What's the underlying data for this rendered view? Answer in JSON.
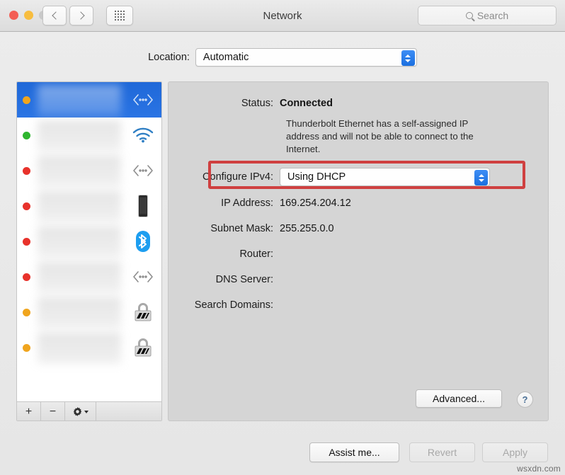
{
  "window": {
    "title": "Network",
    "traffic_lights": [
      {
        "name": "close",
        "color": "#f35e55"
      },
      {
        "name": "minimize",
        "color": "#f7bd3f"
      },
      {
        "name": "zoom",
        "color": "#c9c9c9"
      }
    ],
    "nav": {
      "back": "back-icon",
      "forward": "forward-icon",
      "show_all": "grid-icon"
    },
    "search": {
      "placeholder": "Search",
      "value": "",
      "icon": "search-icon"
    }
  },
  "location": {
    "label": "Location:",
    "selected": "Automatic"
  },
  "sidebar": {
    "services": [
      {
        "status": "orange",
        "icon": "ethernet-icon",
        "label": "",
        "selected": true
      },
      {
        "status": "green",
        "icon": "wifi-icon",
        "label": "",
        "selected": false
      },
      {
        "status": "red",
        "icon": "ethernet-icon",
        "label": "",
        "selected": false
      },
      {
        "status": "red",
        "icon": "iphone-icon",
        "label": "",
        "selected": false
      },
      {
        "status": "red",
        "icon": "bluetooth-icon",
        "label": "",
        "selected": false
      },
      {
        "status": "red",
        "icon": "ethernet-icon",
        "label": "",
        "selected": false
      },
      {
        "status": "orange",
        "icon": "vpn-lock-icon",
        "label": "",
        "selected": false
      },
      {
        "status": "orange",
        "icon": "vpn-lock-icon",
        "label": "",
        "selected": false
      }
    ],
    "toolbar": {
      "add": "+",
      "remove": "−",
      "actions": "gear-icon"
    }
  },
  "detail": {
    "status_label": "Status:",
    "status_value": "Connected",
    "status_description": "Thunderbolt Ethernet has a self-assigned IP address and will not be able to connect to the Internet.",
    "configure_label": "Configure IPv4:",
    "configure_value": "Using DHCP",
    "fields": [
      {
        "label": "IP Address:",
        "value": "169.254.204.12"
      },
      {
        "label": "Subnet Mask:",
        "value": "255.255.0.0"
      },
      {
        "label": "Router:",
        "value": ""
      },
      {
        "label": "DNS Server:",
        "value": ""
      },
      {
        "label": "Search Domains:",
        "value": ""
      }
    ],
    "advanced_label": "Advanced...",
    "help_label": "?",
    "highlight_color": "#cf4040"
  },
  "footer": {
    "assist_label": "Assist me...",
    "revert_label": "Revert",
    "apply_label": "Apply"
  },
  "watermark": "wsxdn.com"
}
